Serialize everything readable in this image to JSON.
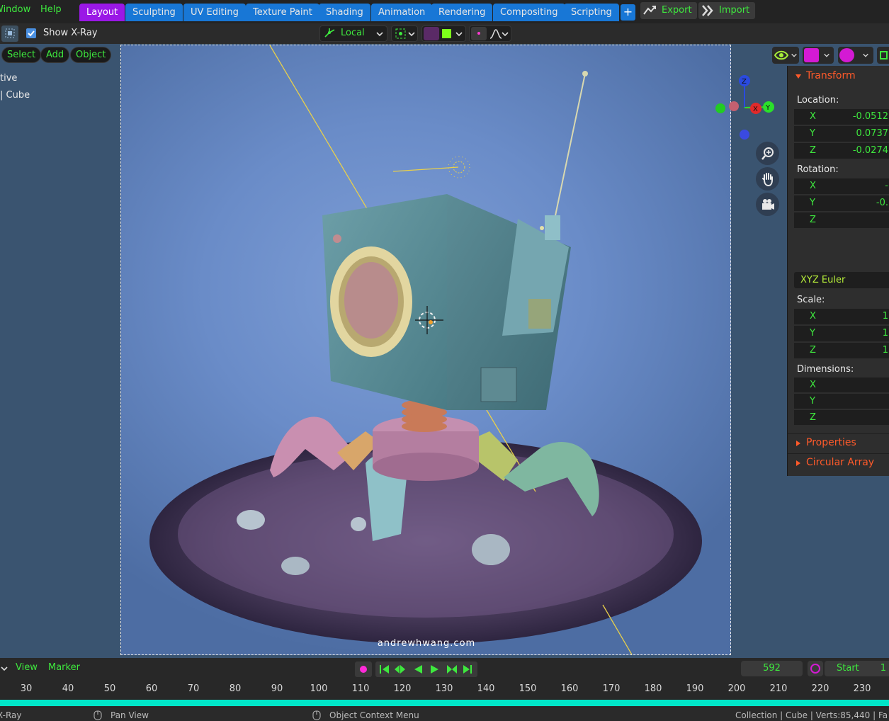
{
  "menubar": {
    "window": "Window",
    "help": "Help"
  },
  "workspace_tabs": [
    "Layout",
    "Sculpting",
    "UV Editing",
    "Texture Paint",
    "Shading",
    "Animation",
    "Rendering",
    "Compositing",
    "Scripting"
  ],
  "active_tab": "Layout",
  "add_workspace": "+",
  "export_label": "Export",
  "import_label": "Import",
  "header": {
    "show_xray": "Show X-Ray",
    "transform_orientation": "Local"
  },
  "viewport_menu": {
    "select": "Select",
    "add": "Add",
    "object": "Object"
  },
  "outliner": {
    "line1": "tive",
    "line2": "| Cube"
  },
  "watermark": "andrewhwang.com",
  "gizmo_axes": {
    "x": "X",
    "y": "Y",
    "z": "Z"
  },
  "sidebar": {
    "transform_title": "Transform",
    "location_label": "Location:",
    "location": [
      {
        "axis": "X",
        "value": "-0.0512"
      },
      {
        "axis": "Y",
        "value": "0.0737"
      },
      {
        "axis": "Z",
        "value": "-0.0274"
      }
    ],
    "rotation_label": "Rotation:",
    "rotation": [
      {
        "axis": "X",
        "value": "-"
      },
      {
        "axis": "Y",
        "value": "-0."
      },
      {
        "axis": "Z",
        "value": ""
      }
    ],
    "rotation_mode": "XYZ Euler",
    "scale_label": "Scale:",
    "scale": [
      {
        "axis": "X",
        "value": "1"
      },
      {
        "axis": "Y",
        "value": "1"
      },
      {
        "axis": "Z",
        "value": "1"
      }
    ],
    "dimensions_label": "Dimensions:",
    "dimensions": [
      {
        "axis": "X",
        "value": ""
      },
      {
        "axis": "Y",
        "value": ""
      },
      {
        "axis": "Z",
        "value": ""
      }
    ],
    "properties_title": "Properties",
    "circular_array_title": "Circular Array"
  },
  "timeline": {
    "view": "View",
    "marker": "Marker",
    "current_frame": "592",
    "start_label": "Start",
    "start_value": "1",
    "ruler": [
      "30",
      "40",
      "50",
      "60",
      "70",
      "80",
      "90",
      "100",
      "110",
      "120",
      "130",
      "140",
      "150",
      "160",
      "170",
      "180",
      "190",
      "200",
      "210",
      "220",
      "230"
    ]
  },
  "statusbar": {
    "left": "X-Ray",
    "pan_view": "Pan View",
    "context_menu": "Object Context Menu",
    "right": "Collection | Cube | Verts:85,440 | Fa"
  },
  "colors": {
    "accent_green": "#3ee83e",
    "tab_blue": "#1877d6",
    "tab_active_purple": "#9a18e6",
    "panel_orange": "#ff5a2a",
    "timeline_cyan": "#00e5c8"
  }
}
